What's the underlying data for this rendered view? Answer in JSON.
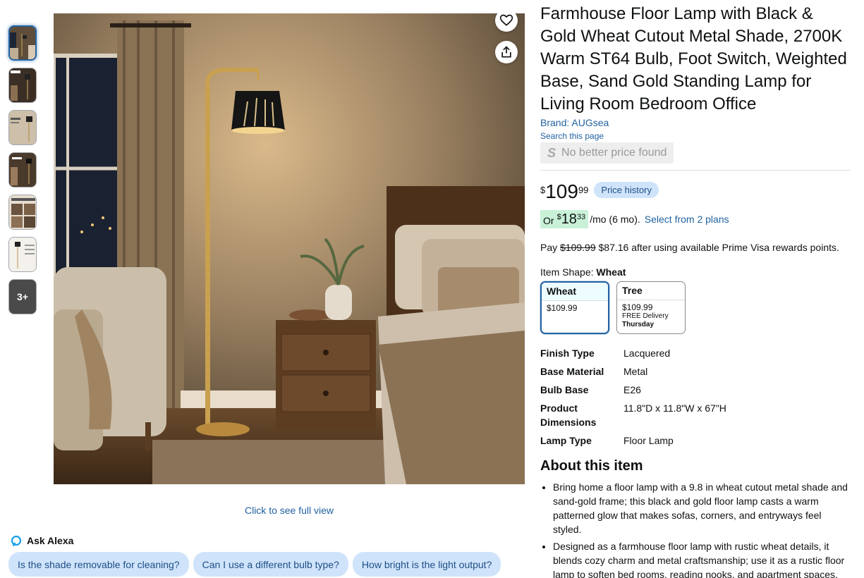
{
  "gallery": {
    "thumbnails": [
      "image-1",
      "image-2",
      "image-3",
      "image-4",
      "image-5",
      "image-6"
    ],
    "more_label": "3+",
    "full_view_label": "Click to see full view"
  },
  "alexa": {
    "label": "Ask Alexa",
    "questions": [
      "Is the shade removable for cleaning?",
      "Can I use a different bulb type?",
      "How bright is the light output?"
    ]
  },
  "product": {
    "title": "Farmhouse Floor Lamp with Black & Gold Wheat Cutout Metal Shade, 2700K Warm ST64 Bulb, Foot Switch, Weighted Base, Sand Gold Standing Lamp for Living Room Bedroom Office",
    "brand": "Brand: AUGsea",
    "search_page": "Search this page",
    "no_better_price": "No better price found",
    "no_better_price_icon": "S"
  },
  "price": {
    "symbol": "$",
    "whole": "109",
    "fraction": "99",
    "history_button": "Price history"
  },
  "monthly": {
    "or": "Or",
    "symbol": "$",
    "whole": "18",
    "fraction": "33",
    "suffix": "/mo (6 mo).",
    "plans_link": "Select from 2 plans"
  },
  "pay": {
    "prefix": "Pay",
    "old_price": "$109.99",
    "rest": "$87.16 after using available Prime Visa rewards points."
  },
  "item_shape": {
    "label": "Item Shape:",
    "selected": "Wheat",
    "options": [
      {
        "name": "Wheat",
        "price": "$109.99",
        "delivery": "",
        "day": ""
      },
      {
        "name": "Tree",
        "price": "$109.99",
        "delivery": "FREE Delivery",
        "day": "Thursday"
      }
    ]
  },
  "specs": [
    {
      "key": "Finish Type",
      "value": "Lacquered"
    },
    {
      "key": "Base Material",
      "value": "Metal"
    },
    {
      "key": "Bulb Base",
      "value": "E26"
    },
    {
      "key": "Product Dimensions",
      "value": "11.8\"D x 11.8\"W x 67\"H"
    },
    {
      "key": "Lamp Type",
      "value": "Floor Lamp"
    }
  ],
  "about": {
    "heading": "About this item",
    "bullets": [
      "Bring home a floor lamp with a 9.8 in wheat cutout metal shade and sand-gold frame; this black and gold floor lamp casts a warm patterned glow that makes sofas, corners, and entryways feel styled.",
      "Designed as a farmhouse floor lamp with rustic wheat details, it blends cozy charm and metal craftsmanship; use it as a rustic floor lamp to soften bed rooms, reading nooks, and apartment spaces."
    ]
  },
  "icons": {
    "wishlist": "heart-icon",
    "share": "share-icon",
    "alexa": "alexa-icon"
  },
  "colors": {
    "link": "#2162a1",
    "chip_bg": "#cfe4fb",
    "deal_bg": "#c9f1d8"
  }
}
